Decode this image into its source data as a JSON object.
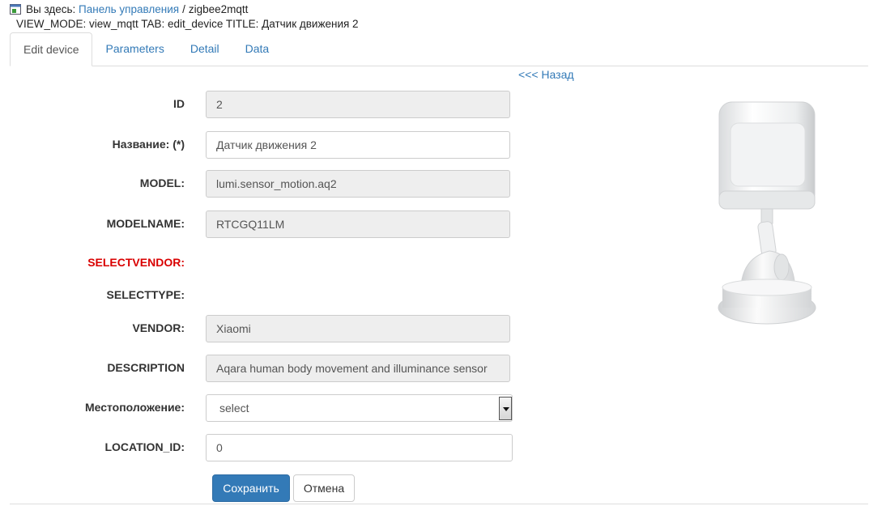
{
  "breadcrumb": {
    "prefix": "Вы здесь:",
    "link": "Панель управления",
    "separator": "/",
    "current": "zigbee2mqtt"
  },
  "view_mode_line": "VIEW_MODE: view_mqtt TAB: edit_device TITLE: Датчик движения 2",
  "tabs": [
    {
      "label": "Edit device",
      "active": true
    },
    {
      "label": "Parameters",
      "active": false
    },
    {
      "label": "Detail",
      "active": false
    },
    {
      "label": "Data",
      "active": false
    }
  ],
  "back_link": "<<< Назад",
  "form": {
    "id": {
      "label": "ID",
      "value": "2"
    },
    "name": {
      "label": "Название: (*)",
      "value": "Датчик движения 2"
    },
    "model": {
      "label": "MODEL:",
      "value": "lumi.sensor_motion.aq2"
    },
    "modelname": {
      "label": "MODELNAME:",
      "value": "RTCGQ11LM"
    },
    "selectvendor": {
      "label": "SELECTVENDOR:"
    },
    "selecttype": {
      "label": "SELECTTYPE:"
    },
    "vendor": {
      "label": "VENDOR:",
      "value": "Xiaomi"
    },
    "description": {
      "label": "DESCRIPTION",
      "value": "Aqara human body movement and illuminance sensor"
    },
    "location": {
      "label": "Местоположение:",
      "value": "select"
    },
    "location_id": {
      "label": "LOCATION_ID:",
      "value": "0"
    }
  },
  "buttons": {
    "save": "Сохранить",
    "cancel": "Отмена"
  },
  "colors": {
    "link": "#337ab7",
    "primary": "#337ab7",
    "required_label": "#d90000"
  },
  "icons": {
    "breadcrumb": "home-window-icon",
    "device": "motion-sensor-image"
  }
}
